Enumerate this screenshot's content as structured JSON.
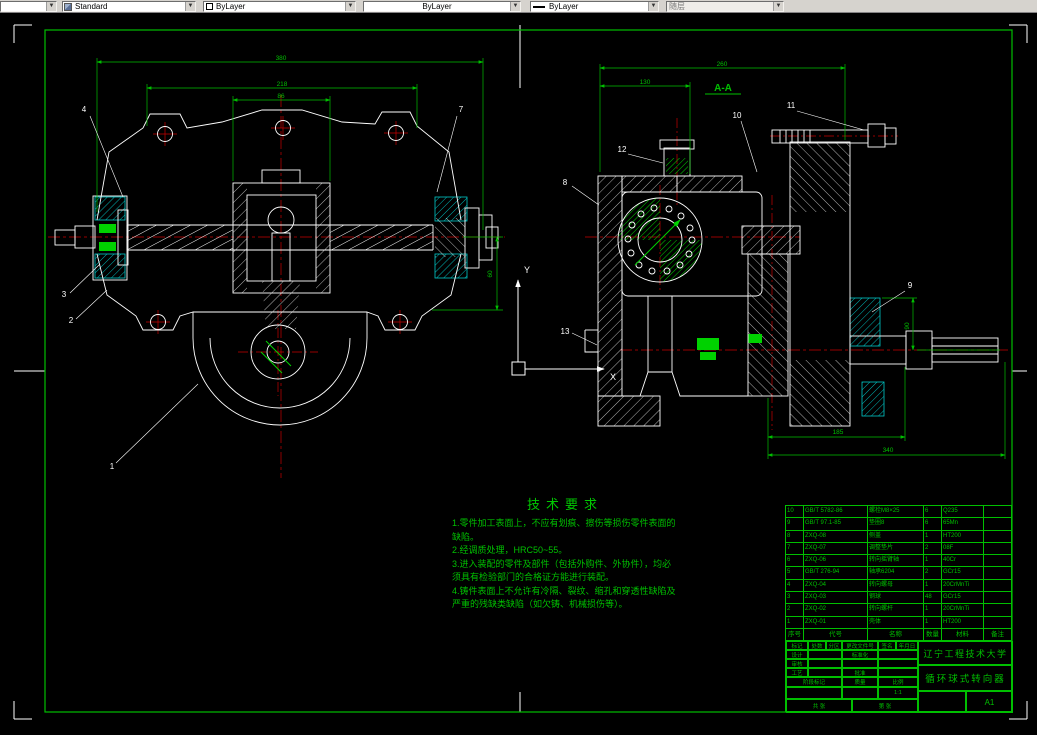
{
  "toolbar": {
    "style": "Standard",
    "color": "ByLayer",
    "linetype": "ByLayer",
    "lineweight": "ByLayer",
    "plotstyle": "随层"
  },
  "drawing": {
    "section_label": "A-A",
    "axis": {
      "x": "X",
      "y": "Y"
    },
    "balloons": [
      "1",
      "2",
      "3",
      "4",
      "7",
      "8",
      "9",
      "10",
      "11",
      "12",
      "13"
    ],
    "dims": {
      "front_overall": "380",
      "front_mid": "218",
      "front_inner": "86",
      "front_height": "60",
      "section_overall": "260",
      "section_mid": "130",
      "section_height": "90",
      "section_bottom_inner": "185",
      "section_bottom": "340"
    },
    "tech": {
      "title": "技术要求",
      "items": [
        "1.零件加工表面上，不应有划痕、擦伤等损伤零件表面的缺陷。",
        "2.经调质处理，HRC50~55。",
        "3.进入装配的零件及部件（包括外购件、外协件），均必须具有检验部门的合格证方能进行装配。",
        "4.铸件表面上不允许有冷隔、裂纹、缩孔和穿透性缺陷及严重的残缺类缺陷（如欠铸、机械损伤等）。"
      ]
    }
  },
  "title_block": {
    "org": "辽宁工程技术大学",
    "drawing_title": "循环球式转向器",
    "sheet_size": "A1",
    "scale": "1:1",
    "labels": {
      "mark": "标记",
      "count": "处数",
      "zone": "分区",
      "change_no": "更改文件号",
      "sign": "签名",
      "date": "年月日",
      "design": "设计",
      "standardize": "标准化",
      "check": "审核",
      "process": "工艺",
      "approve": "批准",
      "stage": "阶段标记",
      "weight": "质量",
      "scale_label": "比例",
      "total_sheets": "共 张",
      "sheet_no": "第 张"
    },
    "bom": {
      "header": {
        "no": "序号",
        "code": "代号",
        "name": "名称",
        "qty": "数量",
        "material": "材料",
        "remark": "备注"
      },
      "rows": [
        {
          "no": "10",
          "code": "GB/T 5782-86",
          "name": "螺栓M8×25",
          "qty": "6",
          "material": "Q235",
          "remark": ""
        },
        {
          "no": "9",
          "code": "GB/T 97.1-85",
          "name": "垫圈8",
          "qty": "6",
          "material": "65Mn",
          "remark": ""
        },
        {
          "no": "8",
          "code": "ZXQ-08",
          "name": "侧盖",
          "qty": "1",
          "material": "HT200",
          "remark": ""
        },
        {
          "no": "7",
          "code": "ZXQ-07",
          "name": "调整垫片",
          "qty": "2",
          "material": "08F",
          "remark": ""
        },
        {
          "no": "6",
          "code": "ZXQ-06",
          "name": "转向摇臂轴",
          "qty": "1",
          "material": "40Cr",
          "remark": ""
        },
        {
          "no": "5",
          "code": "GB/T 276-94",
          "name": "轴承6204",
          "qty": "2",
          "material": "GCr15",
          "remark": ""
        },
        {
          "no": "4",
          "code": "ZXQ-04",
          "name": "转向螺母",
          "qty": "1",
          "material": "20CrMnTi",
          "remark": ""
        },
        {
          "no": "3",
          "code": "ZXQ-03",
          "name": "钢球",
          "qty": "48",
          "material": "GCr15",
          "remark": ""
        },
        {
          "no": "2",
          "code": "ZXQ-02",
          "name": "转向螺杆",
          "qty": "1",
          "material": "20CrMnTi",
          "remark": ""
        },
        {
          "no": "1",
          "code": "ZXQ-01",
          "name": "壳体",
          "qty": "1",
          "material": "HT200",
          "remark": ""
        }
      ]
    }
  }
}
